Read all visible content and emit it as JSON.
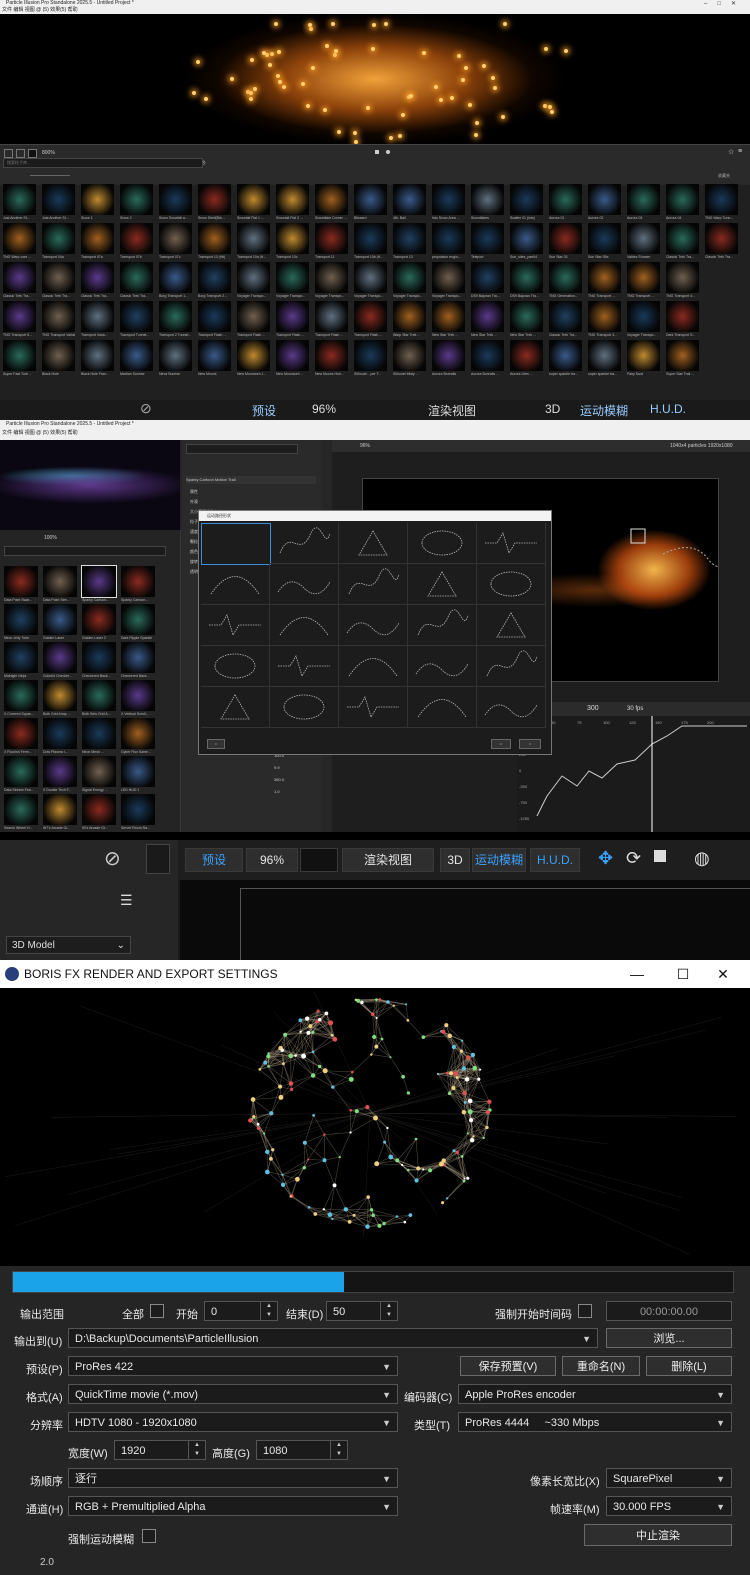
{
  "app1": {
    "title": "Particle Illusion Pro Standalone 2025.5 - Untitled Project *",
    "menu": "文件  编辑  视图  @ (5)  效果(5)  帮助",
    "zoom": "800%",
    "search_placeholder": "搜索粒子库...",
    "library_label": "收藏夹",
    "bottom_labels": [
      "预设",
      "96%",
      "渲染视图",
      "3D",
      "运动模糊",
      "H.U.D."
    ],
    "thumbs_row1": [
      "Just Another St...",
      "Just Another St...",
      "Snow 1",
      "Snow 2",
      "Snow Snowfall a...",
      "Snow Shell(Brk...",
      "Snowfall Flat 1 ...",
      "Snowfall Flat 3 ...",
      "Snowflake Corner ...",
      "Blizzard",
      "4th. Ball",
      "Into Snow Area ...",
      "Snowflakes",
      "Scatter 01 (into)",
      "Aurora 01",
      "Aurora 02",
      "Aurora 03",
      "Aurora 04",
      "TNG Warp Tunn..."
    ],
    "thumbs_row2": [
      "TNG Warp core ...",
      "Transport 04a",
      "Transport 07a",
      "Transport 07b",
      "Transport 07c",
      "Transport 10 (Hit)",
      "Transport 10a (H...",
      "Transport 10c",
      "Transport 11",
      "Transport 10b (H...",
      "Transport 13",
      "propulsion engin...",
      "Teleport",
      "Sun_sites_pan04",
      "Sun Star 03",
      "Sun Star 05a",
      "Valdez Shower",
      "Classic Trek Tra...",
      "Classic Trek Tra..."
    ],
    "thumbs_row3": [
      "Classic Trek Tra...",
      "Classic Trek Tra...",
      "Classic Trek Tra...",
      "Classic Trek Tra...",
      "Borg Transport 1...",
      "Borg Transport 2...",
      "Voyager Transpo...",
      "Voyager Transpo...",
      "Voyager Transpo...",
      "Voyager Transpo...",
      "Voyager Transpo...",
      "Voyager Transpo...",
      "DS9 Bajoran Tra...",
      "DS9 Bajoran Tra...",
      "TNG Generation...",
      "TNG Transport ...",
      "TNG Transport ...",
      "TNG Transport 4..."
    ],
    "thumbs_row4": [
      "TNG Transport 5...",
      "TNG Transport Variat...",
      "Transport Varia...",
      "Transport Tunnel...",
      "Transport 2 Tunnel...",
      "Transport Flash ...",
      "Transport Flash ...",
      "Transport Flash ...",
      "Transport Flash ...",
      "Transport Flash ...",
      "Warp Star Trek ...",
      "New Star Trek ...",
      "New Star Trek ...",
      "New Star Trek ...",
      "Classic Trek Tra...",
      "TNG Transport 3...",
      "Voyager Transpo...",
      "Dark Transport S..."
    ],
    "thumbs_row5": [
      "Super Fast Turb ...",
      "Black Hole",
      "Black Hole Fran...",
      "Martian Sunrise",
      "Neva Sunrise",
      "New Moons",
      "New Moonsorb J...",
      "New Moonsorb ...",
      "New Moons Hori...",
      "Silhouet... per T...",
      "Silhouet Misty ...",
      "Aurora Borealis",
      "Aurora Borealis ...",
      "Aurora Lites ...",
      "super sparkle tra...",
      "super sparkle tra...",
      "Fairy Dust",
      "Super Star Trail ..."
    ]
  },
  "app2": {
    "title": "Particle Illusion Pro Standalone 2025.5 - Untitled Project *",
    "menu": "文件  编辑  视图  @ (5)  效果(5)  帮助",
    "zoom": "100%",
    "emitter_name": "Sparky Cartoon Motion Trail",
    "viewer_zoom": "96%",
    "viewer_info": "1040x4 particles  1920x1080",
    "frame": "300",
    "fps": "30 fps",
    "dialog_title": "运动路径形状",
    "library_items": [
      "Data Point Swar...",
      "Data Point Stre...",
      "Sparky Cartoon...",
      "Sparky Cartoon...",
      "Neon Jelly Tube",
      "Golden Laser",
      "Golden Laser 2",
      "Dark Ripple Sparkle",
      "Midnight Ninja",
      "Colorful Checker...",
      "Checkered Back...",
      "Checkered Back...",
      "X Covered Squar...",
      "Bulb Grid Array ...",
      "Bulb Sets Grid A...",
      "X Vertical Scroll...",
      "X Flourish Ferm...",
      "Dots Plasma I...",
      "Neon Mesh ...",
      "Cyber Flux Saine...",
      "Data Stream Fea...",
      "X Double Tech F...",
      "Signal Energy ...",
      "LED HUD 1",
      "Search Wheel H...",
      "W7's Arcade Gr...",
      "90's Arcade Gr...",
      "Server Room Ra..."
    ],
    "props": [
      "Sparky Cartoon Motion Trail",
      "属性",
      "外观",
      "大小值随机的大小",
      "粒子",
      "速度",
      "颗粒数量",
      "颜色",
      "旋转",
      "透明度"
    ],
    "values": [
      "0.0",
      "100.0",
      "9.9",
      "360.0",
      "1.0"
    ],
    "graph_ticks": [
      "50",
      "75",
      "100",
      "125",
      "150",
      "175",
      "200"
    ],
    "graph_yticks": [
      "250",
      "0",
      "-250",
      "-750",
      "-1250"
    ]
  },
  "app3": {
    "top_buttons": [
      "预设",
      "96%",
      "渲染视图",
      "3D",
      "运动模糊",
      "H.U.D."
    ],
    "model_select": "3D Model",
    "dialog_title": "BORIS FX RENDER AND EXPORT SETTINGS",
    "progress": 0.46,
    "labels": {
      "output_range": "输出范围",
      "all": "全部",
      "start": "开始",
      "end": "结束(D)",
      "force_start_tc": "强制开始时间码",
      "output_to": "输出到(U)",
      "preset": "预设(P)",
      "format": "格式(A)",
      "codec": "编码器(C)",
      "resolution": "分辨率",
      "type": "类型(T)",
      "width": "宽度(W)",
      "height": "高度(G)",
      "field_order": "场顺序",
      "pixel_aspect": "像素长宽比(X)",
      "channels": "通道(H)",
      "frame_rate": "帧速率(M)",
      "force_motion_blur": "强制运动模糊"
    },
    "values": {
      "start": "0",
      "end": "50",
      "timecode": "00:00:00.00",
      "path": "D:\\Backup\\Documents\\ParticleIllusion",
      "preset": "ProRes 422",
      "format": "QuickTime movie (*.mov)",
      "codec": "Apple ProRes encoder",
      "resolution": "HDTV 1080 - 1920x1080",
      "type": "ProRes 4444     ~330 Mbps",
      "width": "1920",
      "height": "1080",
      "field_order": "逐行",
      "pixel_aspect": "SquarePixel",
      "channels": "RGB + Premultiplied Alpha",
      "frame_rate": "30.000 FPS"
    },
    "buttons": {
      "browse": "浏览...",
      "save_preset": "保存预置(V)",
      "rename": "重命名(N)",
      "delete": "删除(L)",
      "abort": "中止渲染"
    },
    "version": "2.0"
  },
  "colors": {
    "accent": "#1aa3e8",
    "blue_text": "#3ba1ff",
    "dialog_bg": "#252525"
  }
}
